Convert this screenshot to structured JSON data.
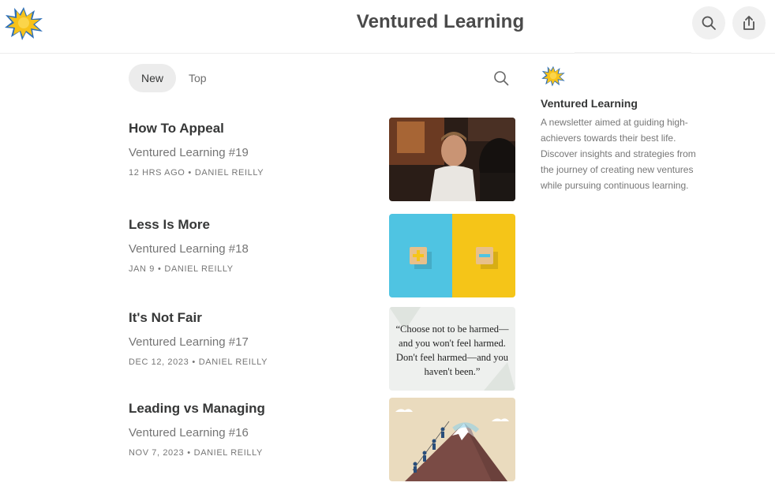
{
  "header": {
    "title": "Ventured Learning",
    "logo_icon": "starburst-logo-icon",
    "search_icon": "search-icon",
    "share_icon": "share-icon"
  },
  "tabs": [
    {
      "label": "New",
      "active": true
    },
    {
      "label": "Top",
      "active": false
    }
  ],
  "posts": [
    {
      "title": "How To Appeal",
      "subtitle": "Ventured Learning #19",
      "date": "12 HRS AGO",
      "author": "DANIEL REILLY",
      "thumbnail": "two-men-talking-photo"
    },
    {
      "title": "Less Is More",
      "subtitle": "Ventured Learning #18",
      "date": "JAN 9",
      "author": "DANIEL REILLY",
      "thumbnail": "plus-minus-blocks-photo"
    },
    {
      "title": "It's Not Fair",
      "subtitle": "Ventured Learning #17",
      "date": "DEC 12, 2023",
      "author": "DANIEL REILLY",
      "thumbnail": "quote-image"
    },
    {
      "title": "Leading vs Managing",
      "subtitle": "Ventured Learning #16",
      "date": "NOV 7, 2023",
      "author": "DANIEL REILLY",
      "thumbnail": "mountain-climbers-illustration"
    }
  ],
  "quote": {
    "line1": "“Choose not to be harmed—",
    "line2": "and you won't feel harmed.",
    "line3": "Don't feel harmed—and you",
    "line4": "haven't been.”"
  },
  "sidebar": {
    "name": "Ventured Learning",
    "description": "A newsletter aimed at guiding high-achievers towards their best life. Discover insights and strategies from the journey of creating new ventures while pursuing continuous learning."
  },
  "colors": {
    "logo_yellow": "#f7c21a",
    "logo_blue": "#2d6fb8",
    "tab_active_bg": "#ececec"
  }
}
